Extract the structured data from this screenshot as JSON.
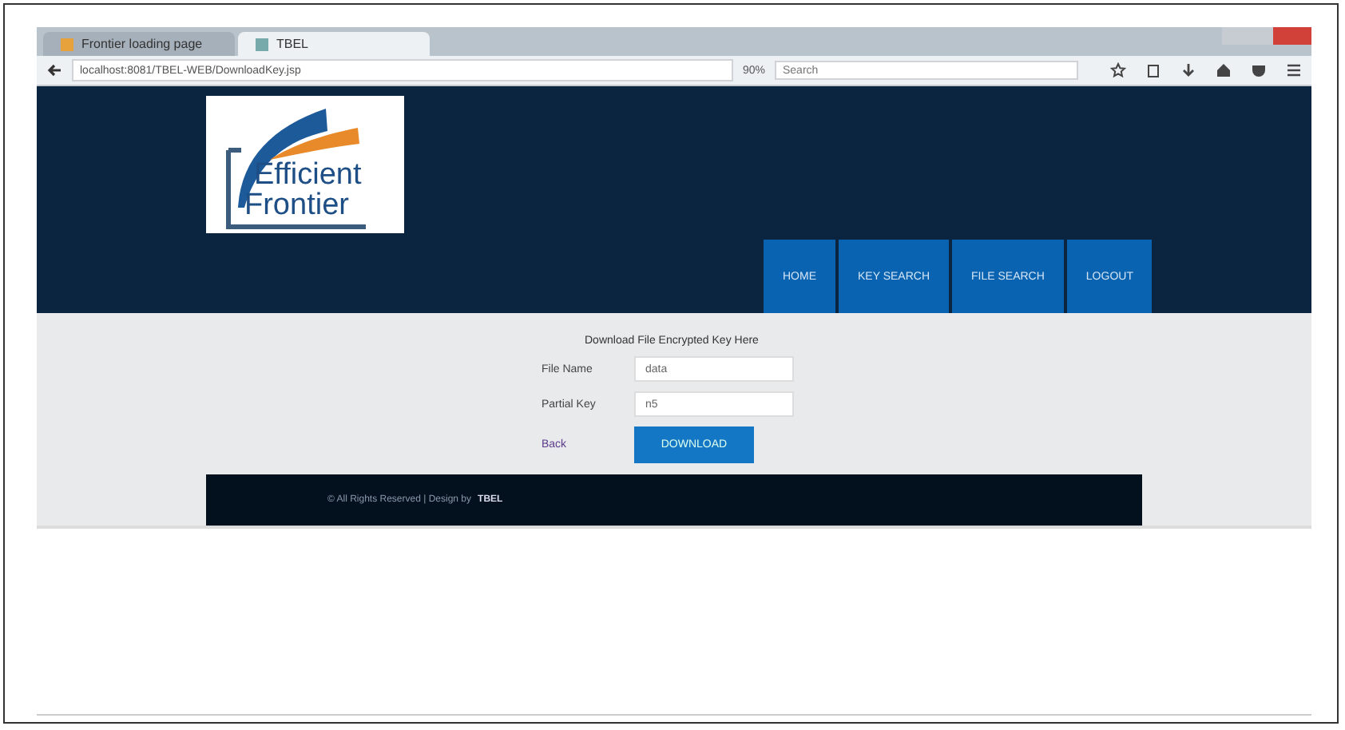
{
  "browser": {
    "tabs": [
      {
        "label": "Frontier loading page",
        "selected": false
      },
      {
        "label": "TBEL",
        "selected": true
      }
    ],
    "url": "localhost:8081/TBEL-WEB/DownloadKey.jsp",
    "zoom": "90%",
    "search": {
      "placeholder": "Search"
    }
  },
  "header": {
    "logo": [
      "Efficient",
      "Frontier"
    ],
    "nav": [
      {
        "label": "HOME"
      },
      {
        "label": "KEY SEARCH"
      },
      {
        "label": "FILE SEARCH"
      },
      {
        "label": "LOGOUT"
      }
    ]
  },
  "form": {
    "title": "Download File Encrypted Key Here",
    "fields": [
      {
        "label": "File Name",
        "value": "data"
      },
      {
        "label": "Partial Key",
        "value": "n5"
      }
    ],
    "back": "Back",
    "button": "DOWNLOAD"
  },
  "footer": {
    "text": "© All Rights Reserved | Design by",
    "brand": "TBEL"
  }
}
